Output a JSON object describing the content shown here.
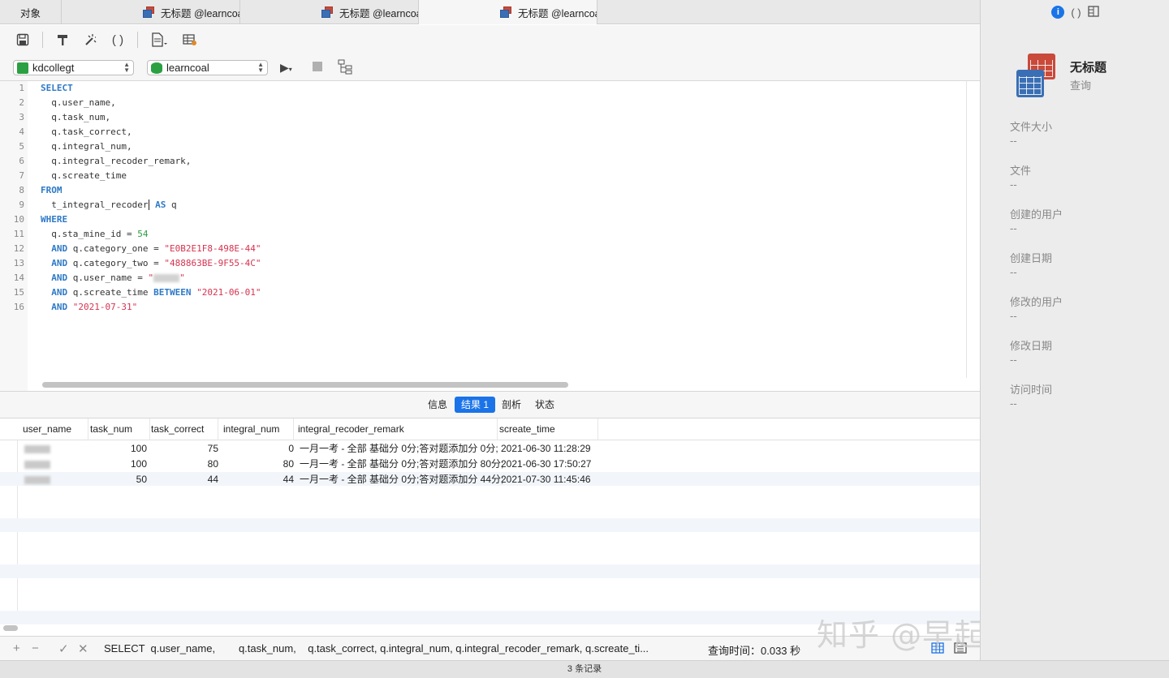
{
  "tabs": {
    "objects_label": "对象",
    "doc_tabs": [
      {
        "label": "无标题 @learncoal (kdcol..."
      },
      {
        "label": "无标题 @learncoal (kdcol..."
      },
      {
        "label": "无标题 @learncoal (kdcol..."
      }
    ]
  },
  "toolbar": {
    "connection": "kdcollegt",
    "database": "learncoal"
  },
  "editor": {
    "line_numbers": [
      "1",
      "2",
      "3",
      "4",
      "5",
      "6",
      "7",
      "8",
      "9",
      "10",
      "11",
      "12",
      "13",
      "14",
      "15",
      "16"
    ],
    "line1": "SELECT",
    "line2": "  q.user_name,",
    "line3": "  q.task_num,",
    "line4": "  q.task_correct,",
    "line5": "  q.integral_num,",
    "line6": "  q.integral_recoder_remark,",
    "line7": "  q.screate_time",
    "line8": "FROM",
    "line9_a": "  t_integral_recoder",
    "line9_kw": "AS",
    "line9_b": " q",
    "line10": "WHERE",
    "line11_a": "  q.sta_mine_id = ",
    "line11_num": "54",
    "and_kw": "AND",
    "line12_a": " q.category_one = ",
    "line12_str": "\"E0B2E1F8-498E-44\"",
    "line13_a": " q.category_two = ",
    "line13_str": "\"488863BE-9F55-4C\"",
    "line14_a": " q.user_name = ",
    "line14_q1": "\"",
    "line14_q2": "\"",
    "line15_a": " q.screate_time ",
    "between_kw": "BETWEEN",
    "line15_str": "\"2021-06-01\"",
    "line16_str": "\"2021-07-31\""
  },
  "result_tabs": {
    "info": "信息",
    "result1": "结果 1",
    "profile": "剖析",
    "status": "状态"
  },
  "grid": {
    "columns": [
      "user_name",
      "task_num",
      "task_correct",
      "integral_num",
      "integral_recoder_remark",
      "screate_time"
    ],
    "rows": [
      {
        "task_num": "100",
        "task_correct": "75",
        "integral_num": "0",
        "remark": "一月一考 - 全部 基础分 0分;答对题添加分 0分;",
        "time": "2021-06-30 11:28:29"
      },
      {
        "task_num": "100",
        "task_correct": "80",
        "integral_num": "80",
        "remark": "一月一考 - 全部 基础分 0分;答对题添加分 80分;",
        "time": "2021-06-30 17:50:27"
      },
      {
        "task_num": "50",
        "task_correct": "44",
        "integral_num": "44",
        "remark": "一月一考 - 全部 基础分 0分;答对题添加分 44分;",
        "time": "2021-07-30 11:45:46"
      }
    ]
  },
  "bottom": {
    "sql_preview": "SELECT  q.user_name,        q.task_num,    q.task_correct, q.integral_num, q.integral_recoder_remark, q.screate_ti...",
    "query_time": "查询时间：0.033 秒",
    "record_count": "3 条记录"
  },
  "panel": {
    "title": "无标题",
    "subtitle": "查询",
    "properties": [
      {
        "label": "文件大小",
        "value": "--"
      },
      {
        "label": "文件",
        "value": "--"
      },
      {
        "label": "创建的用户",
        "value": "--"
      },
      {
        "label": "创建日期",
        "value": "--"
      },
      {
        "label": "修改的用户",
        "value": "--"
      },
      {
        "label": "修改日期",
        "value": "--"
      },
      {
        "label": "访问时间",
        "value": "--"
      }
    ]
  },
  "watermark": "知乎 @早起的年轻人",
  "colors": {
    "accent": "#1a73e8",
    "keyword": "#2e79c6",
    "string": "#d6334f",
    "number": "#2aa043"
  }
}
